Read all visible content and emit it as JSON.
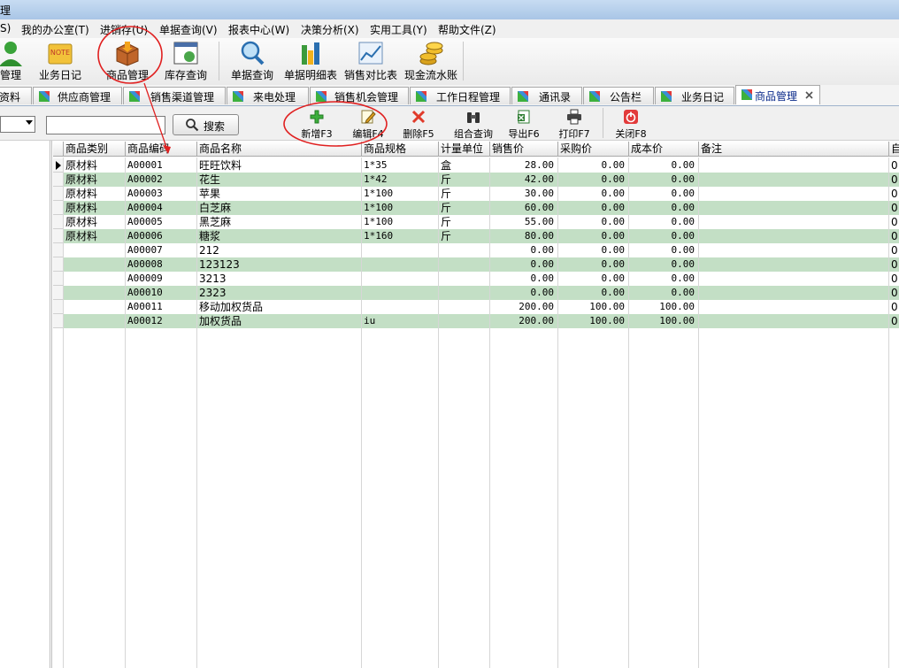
{
  "window": {
    "title": "理"
  },
  "menu": [
    "S)",
    "我的办公室(T)",
    "进销存(U)",
    "单据查询(V)",
    "报表中心(W)",
    "决策分析(X)",
    "实用工具(Y)",
    "帮助文件(Z)"
  ],
  "toolbar": [
    {
      "label": "管理",
      "icon": "user-icon"
    },
    {
      "label": "业务日记",
      "icon": "note-icon"
    },
    {
      "label": "商品管理",
      "icon": "box-icon"
    },
    {
      "label": "库存查询",
      "icon": "inventory-icon"
    },
    {
      "label": "单据查询",
      "icon": "magnifier-icon"
    },
    {
      "label": "单据明细表",
      "icon": "bar-chart-icon"
    },
    {
      "label": "销售对比表",
      "icon": "line-chart-icon"
    },
    {
      "label": "现金流水账",
      "icon": "coins-icon"
    }
  ],
  "tabs": [
    {
      "label": "资料"
    },
    {
      "label": "供应商管理"
    },
    {
      "label": "销售渠道管理"
    },
    {
      "label": "来电处理"
    },
    {
      "label": "销售机会管理"
    },
    {
      "label": "工作日程管理"
    },
    {
      "label": "通讯录"
    },
    {
      "label": "公告栏"
    },
    {
      "label": "业务日记"
    },
    {
      "label": "商品管理",
      "active": true
    }
  ],
  "search": {
    "button_label": "搜索",
    "value": ""
  },
  "actions": [
    {
      "label": "新增F3",
      "icon": "plus-icon"
    },
    {
      "label": "编辑F4",
      "icon": "edit-icon"
    },
    {
      "label": "删除F5",
      "icon": "delete-icon"
    },
    {
      "label": "组合查询",
      "icon": "binoculars-icon"
    },
    {
      "label": "导出F6",
      "icon": "excel-icon"
    },
    {
      "label": "打印F7",
      "icon": "printer-icon"
    },
    {
      "label": "关闭F8",
      "icon": "power-icon"
    }
  ],
  "table": {
    "columns": [
      "商品类别",
      "商品编码",
      "商品名称",
      "商品规格",
      "计量单位",
      "销售价",
      "采购价",
      "成本价",
      "备注",
      "自"
    ],
    "rows": [
      [
        "原材料",
        "A00001",
        "旺旺饮料",
        "1*35",
        "盒",
        "28.00",
        "0.00",
        "0.00",
        "",
        "0"
      ],
      [
        "原材料",
        "A00002",
        "花生",
        "1*42",
        "斤",
        "42.00",
        "0.00",
        "0.00",
        "",
        "0"
      ],
      [
        "原材料",
        "A00003",
        "苹果",
        "1*100",
        "斤",
        "30.00",
        "0.00",
        "0.00",
        "",
        "0"
      ],
      [
        "原材料",
        "A00004",
        "白芝麻",
        "1*100",
        "斤",
        "60.00",
        "0.00",
        "0.00",
        "",
        "0"
      ],
      [
        "原材料",
        "A00005",
        "黑芝麻",
        "1*100",
        "斤",
        "55.00",
        "0.00",
        "0.00",
        "",
        "0"
      ],
      [
        "原材料",
        "A00006",
        "糖浆",
        "1*160",
        "斤",
        "80.00",
        "0.00",
        "0.00",
        "",
        "0"
      ],
      [
        "",
        "A00007",
        "212",
        "",
        "",
        "0.00",
        "0.00",
        "0.00",
        "",
        "0"
      ],
      [
        "",
        "A00008",
        "123123",
        "",
        "",
        "0.00",
        "0.00",
        "0.00",
        "",
        "0"
      ],
      [
        "",
        "A00009",
        "3213",
        "",
        "",
        "0.00",
        "0.00",
        "0.00",
        "",
        "0"
      ],
      [
        "",
        "A00010",
        "2323",
        "",
        "",
        "0.00",
        "0.00",
        "0.00",
        "",
        "0"
      ],
      [
        "",
        "A00011",
        "移动加权货品",
        "",
        "",
        "200.00",
        "100.00",
        "100.00",
        "",
        "0"
      ],
      [
        "",
        "A00012",
        "加权货品",
        "iu",
        "",
        "200.00",
        "100.00",
        "100.00",
        "",
        "0"
      ]
    ]
  },
  "colors": {
    "alt_row": "#c3dfc5",
    "annotation": "#e02020",
    "active_tab_text": "#0a2a8a"
  }
}
